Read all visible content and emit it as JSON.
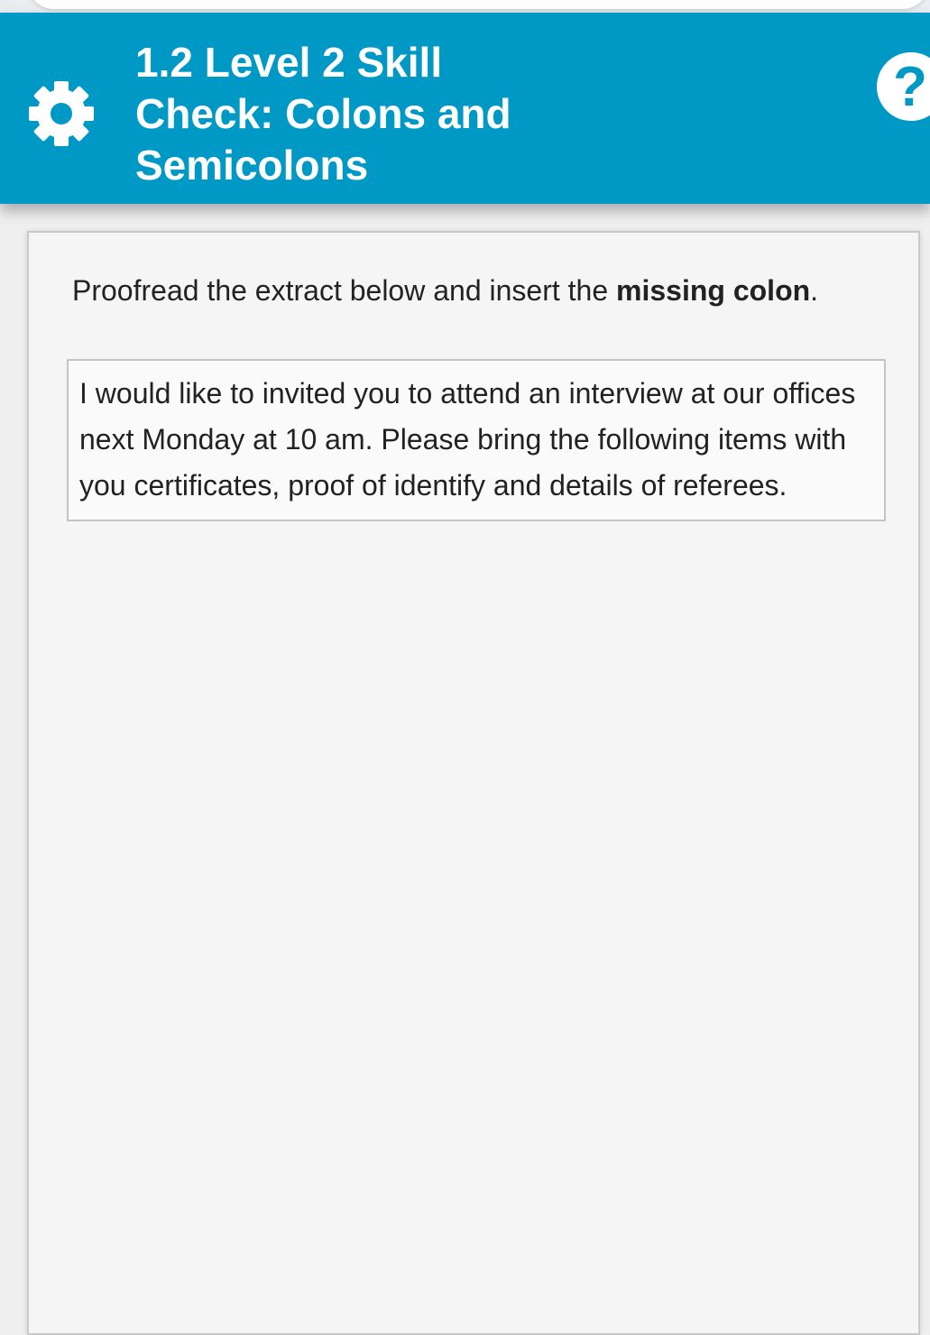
{
  "header": {
    "title": "1.2 Level 2 Skill Check: Colons and Semicolons",
    "settings_icon": "gear-icon",
    "help_icon": "help-icon",
    "help_glyph": "?",
    "background_color": "#0099c6"
  },
  "instruction": {
    "prefix": "Proofread the extract below and insert the ",
    "emphasis": "missing colon",
    "suffix": "."
  },
  "extract": {
    "text": "I would like to invited you to attend an interview at our offices next Monday at 10 am. Please bring the following items with you certificates, proof of identify and details of referees."
  }
}
